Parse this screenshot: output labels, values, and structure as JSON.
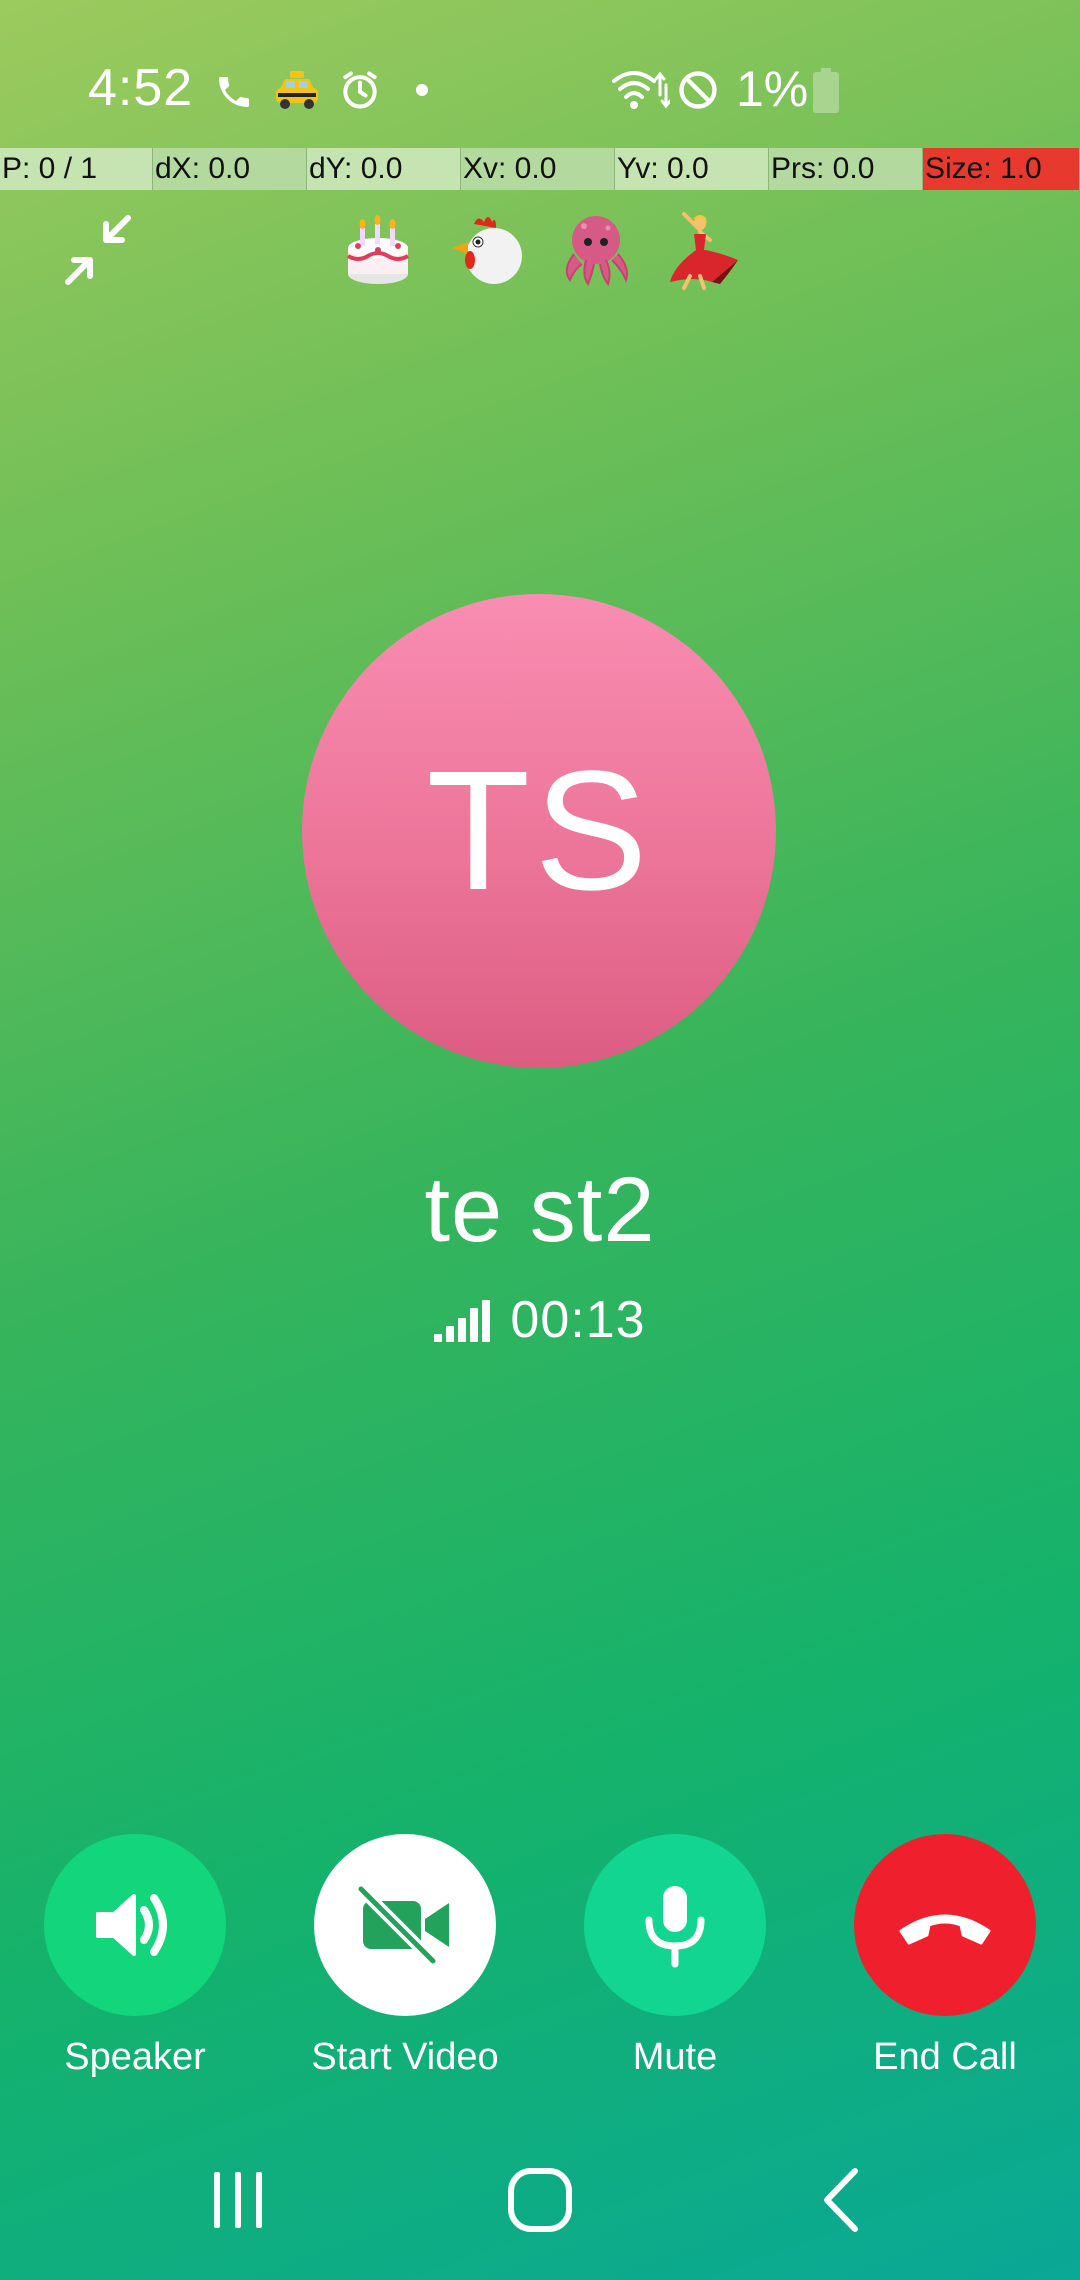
{
  "status_bar": {
    "time": "4:52",
    "battery_percent": "1%",
    "icons": [
      "phone-call-icon",
      "taxi-icon",
      "alarm-icon",
      "notification-dot-icon",
      "wifi-icon",
      "do-not-disturb-icon",
      "battery-icon"
    ]
  },
  "debug_overlay": {
    "pointer": "P: 0 / 1",
    "dx": "dX: 0.0",
    "dy": "dY: 0.0",
    "xv": "Xv: 0.0",
    "yv": "Yv: 0.0",
    "prs": "Prs: 0.0",
    "size": "Size: 1.0"
  },
  "header": {
    "minimize_icon": "minimize-icon",
    "emojis": [
      "birthday-cake-emoji",
      "chicken-emoji",
      "octopus-emoji",
      "dancer-emoji"
    ]
  },
  "contact": {
    "initials": "TS",
    "name": "te st2",
    "call_duration": "00:13",
    "signal_icon": "signal-strength-icon"
  },
  "controls": {
    "speaker": "Speaker",
    "start_video": "Start Video",
    "mute": "Mute",
    "end_call": "End Call"
  },
  "colors": {
    "avatar": "#ec7599",
    "end_call": "#ef1f2e",
    "speaker_button": "#13d67c",
    "mute_button": "#12d592",
    "video_button": "#ffffff",
    "video_icon": "#23a25c"
  },
  "nav_bar": {
    "icons": [
      "recent-apps-icon",
      "home-icon",
      "back-icon"
    ]
  }
}
